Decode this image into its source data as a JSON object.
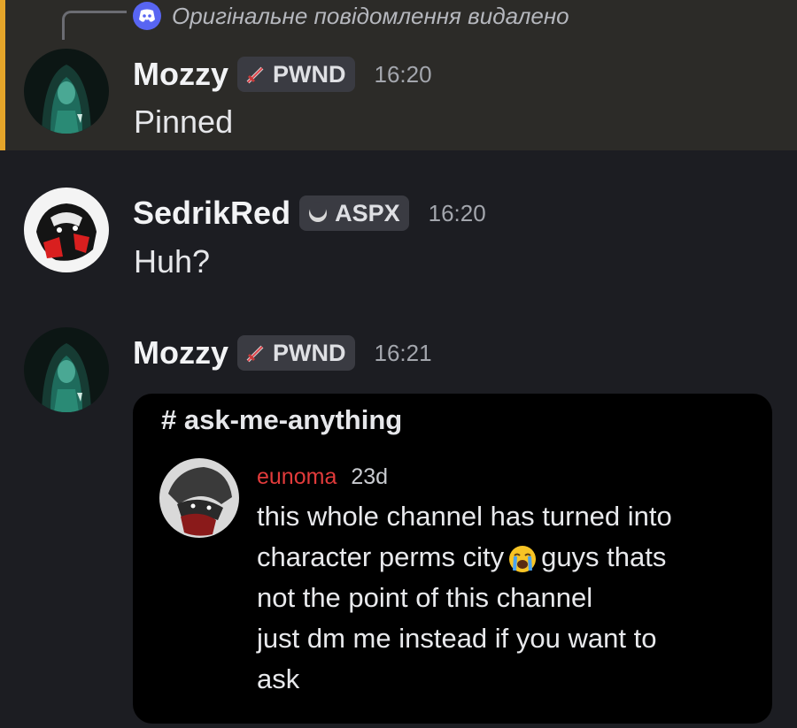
{
  "reply": {
    "text": "Оригінальне повідомлення видалено",
    "icon": "discord-icon"
  },
  "messages": [
    {
      "username": "Mozzy",
      "tag_label": "PWND",
      "tag_icon": "sword-icon",
      "time": "16:20",
      "text": "Pinned"
    },
    {
      "username": "SedrikRed",
      "tag_label": "ASPX",
      "tag_icon": "crescent-icon",
      "time": "16:20",
      "text": "Huh?"
    },
    {
      "username": "Mozzy",
      "tag_label": "PWND",
      "tag_icon": "sword-icon",
      "time": "16:21"
    }
  ],
  "embed": {
    "channel": "# ask-me-anything",
    "author": "eunoma",
    "time": "23d",
    "lines": [
      "this whole channel has turned into",
      "character perms city",
      "guys thats",
      "not the point of this channel",
      "just dm me instead if you want to",
      "ask"
    ],
    "emoji": "loudly-crying-face"
  },
  "colors": {
    "accent_bar": "#e5a52a",
    "discord_blurple": "#5865f2",
    "embed_author": "#e23b3b"
  }
}
